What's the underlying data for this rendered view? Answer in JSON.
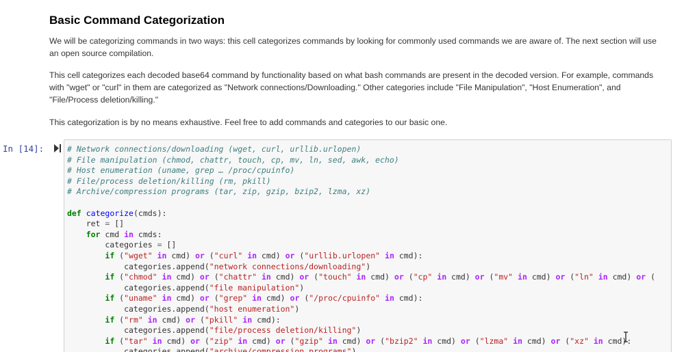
{
  "markdown": {
    "heading": "Basic Command Categorization",
    "paragraphs": [
      "We will be categorizing commands in two ways: this cell categorizes commands by looking for commonly used commands we are aware of. The next section will use an open source compilation.",
      "This cell categorizes each decoded base64 command by functionality based on what bash commands are present in the decoded version. For example, commands with \"wget\" or \"curl\" in them are categorized as \"Network connections/Downloading.\" Other categories include \"File Manipulation\", \"Host Enumeration\", and \"File/Process deletion/killing.\"",
      "This categorization is by no means exhaustive. Feel free to add commands and categories to our basic one."
    ]
  },
  "cell": {
    "prompt": "In [14]:",
    "icons": {
      "run": "run-cell-icon",
      "cursor": "text-cursor-icon"
    },
    "code_lines": [
      [
        [
          "c",
          "# Network connections/downloading (wget, curl, urllib.urlopen)"
        ]
      ],
      [
        [
          "c",
          "# File manipulation (chmod, chattr, touch, cp, mv, ln, sed, awk, echo)"
        ]
      ],
      [
        [
          "c",
          "# Host enumeration (uname, grep … /proc/cpuinfo)"
        ]
      ],
      [
        [
          "c",
          "# File/process deletion/killing (rm, pkill)"
        ]
      ],
      [
        [
          "c",
          "# Archive/compression programs (tar, zip, gzip, bzip2, lzma, xz)"
        ]
      ],
      [],
      [
        [
          "k",
          "def"
        ],
        [
          "",
          " "
        ],
        [
          "nf",
          "categorize"
        ],
        [
          "",
          "(cmds):"
        ]
      ],
      [
        [
          "",
          "    ret "
        ],
        [
          "o",
          "="
        ],
        [
          "",
          " []"
        ]
      ],
      [
        [
          "",
          "    "
        ],
        [
          "k",
          "for"
        ],
        [
          "",
          " cmd "
        ],
        [
          "ow",
          "in"
        ],
        [
          "",
          " cmds:"
        ]
      ],
      [
        [
          "",
          "        categories "
        ],
        [
          "o",
          "="
        ],
        [
          "",
          " []"
        ]
      ],
      [
        [
          "",
          "        "
        ],
        [
          "k",
          "if"
        ],
        [
          "",
          " ("
        ],
        [
          "s",
          "\"wget\""
        ],
        [
          "",
          " "
        ],
        [
          "ow",
          "in"
        ],
        [
          "",
          " cmd) "
        ],
        [
          "ow",
          "or"
        ],
        [
          "",
          " ("
        ],
        [
          "s",
          "\"curl\""
        ],
        [
          "",
          " "
        ],
        [
          "ow",
          "in"
        ],
        [
          "",
          " cmd) "
        ],
        [
          "ow",
          "or"
        ],
        [
          "",
          " ("
        ],
        [
          "s",
          "\"urllib.urlopen\""
        ],
        [
          "",
          " "
        ],
        [
          "ow",
          "in"
        ],
        [
          "",
          " cmd):"
        ]
      ],
      [
        [
          "",
          "            categories.append("
        ],
        [
          "s",
          "\"network connections/downloading\""
        ],
        [
          "",
          ")"
        ]
      ],
      [
        [
          "",
          "        "
        ],
        [
          "k",
          "if"
        ],
        [
          "",
          " ("
        ],
        [
          "s",
          "\"chmod\""
        ],
        [
          "",
          " "
        ],
        [
          "ow",
          "in"
        ],
        [
          "",
          " cmd) "
        ],
        [
          "ow",
          "or"
        ],
        [
          "",
          " ("
        ],
        [
          "s",
          "\"chattr\""
        ],
        [
          "",
          " "
        ],
        [
          "ow",
          "in"
        ],
        [
          "",
          " cmd) "
        ],
        [
          "ow",
          "or"
        ],
        [
          "",
          " ("
        ],
        [
          "s",
          "\"touch\""
        ],
        [
          "",
          " "
        ],
        [
          "ow",
          "in"
        ],
        [
          "",
          " cmd) "
        ],
        [
          "ow",
          "or"
        ],
        [
          "",
          " ("
        ],
        [
          "s",
          "\"cp\""
        ],
        [
          "",
          " "
        ],
        [
          "ow",
          "in"
        ],
        [
          "",
          " cmd) "
        ],
        [
          "ow",
          "or"
        ],
        [
          "",
          " ("
        ],
        [
          "s",
          "\"mv\""
        ],
        [
          "",
          " "
        ],
        [
          "ow",
          "in"
        ],
        [
          "",
          " cmd) "
        ],
        [
          "ow",
          "or"
        ],
        [
          "",
          " ("
        ],
        [
          "s",
          "\"ln\""
        ],
        [
          "",
          " "
        ],
        [
          "ow",
          "in"
        ],
        [
          "",
          " cmd) "
        ],
        [
          "ow",
          "or"
        ],
        [
          "",
          " ("
        ]
      ],
      [
        [
          "",
          "            categories.append("
        ],
        [
          "s",
          "\"file manipulation\""
        ],
        [
          "",
          ")"
        ]
      ],
      [
        [
          "",
          "        "
        ],
        [
          "k",
          "if"
        ],
        [
          "",
          " ("
        ],
        [
          "s",
          "\"uname\""
        ],
        [
          "",
          " "
        ],
        [
          "ow",
          "in"
        ],
        [
          "",
          " cmd) "
        ],
        [
          "ow",
          "or"
        ],
        [
          "",
          " ("
        ],
        [
          "s",
          "\"grep\""
        ],
        [
          "",
          " "
        ],
        [
          "ow",
          "in"
        ],
        [
          "",
          " cmd) "
        ],
        [
          "ow",
          "or"
        ],
        [
          "",
          " ("
        ],
        [
          "s",
          "\"/proc/cpuinfo\""
        ],
        [
          "",
          " "
        ],
        [
          "ow",
          "in"
        ],
        [
          "",
          " cmd):"
        ]
      ],
      [
        [
          "",
          "            categories.append("
        ],
        [
          "s",
          "\"host enumeration\""
        ],
        [
          "",
          ")"
        ]
      ],
      [
        [
          "",
          "        "
        ],
        [
          "k",
          "if"
        ],
        [
          "",
          " ("
        ],
        [
          "s",
          "\"rm\""
        ],
        [
          "",
          " "
        ],
        [
          "ow",
          "in"
        ],
        [
          "",
          " cmd) "
        ],
        [
          "ow",
          "or"
        ],
        [
          "",
          " ("
        ],
        [
          "s",
          "\"pkill\""
        ],
        [
          "",
          " "
        ],
        [
          "ow",
          "in"
        ],
        [
          "",
          " cmd):"
        ]
      ],
      [
        [
          "",
          "            categories.append("
        ],
        [
          "s",
          "\"file/process deletion/killing\""
        ],
        [
          "",
          ")"
        ]
      ],
      [
        [
          "",
          "        "
        ],
        [
          "k",
          "if"
        ],
        [
          "",
          " ("
        ],
        [
          "s",
          "\"tar\""
        ],
        [
          "",
          " "
        ],
        [
          "ow",
          "in"
        ],
        [
          "",
          " cmd) "
        ],
        [
          "ow",
          "or"
        ],
        [
          "",
          " ("
        ],
        [
          "s",
          "\"zip\""
        ],
        [
          "",
          " "
        ],
        [
          "ow",
          "in"
        ],
        [
          "",
          " cmd) "
        ],
        [
          "ow",
          "or"
        ],
        [
          "",
          " ("
        ],
        [
          "s",
          "\"gzip\""
        ],
        [
          "",
          " "
        ],
        [
          "ow",
          "in"
        ],
        [
          "",
          " cmd) "
        ],
        [
          "ow",
          "or"
        ],
        [
          "",
          " ("
        ],
        [
          "s",
          "\"bzip2\""
        ],
        [
          "",
          " "
        ],
        [
          "ow",
          "in"
        ],
        [
          "",
          " cmd) "
        ],
        [
          "ow",
          "or"
        ],
        [
          "",
          " ("
        ],
        [
          "s",
          "\"lzma\""
        ],
        [
          "",
          " "
        ],
        [
          "ow",
          "in"
        ],
        [
          "",
          " cmd) "
        ],
        [
          "ow",
          "or"
        ],
        [
          "",
          " ("
        ],
        [
          "s",
          "\"xz\""
        ],
        [
          "",
          " "
        ],
        [
          "ow",
          "in"
        ],
        [
          "",
          " cmd):"
        ]
      ],
      [
        [
          "",
          "            categories.append("
        ],
        [
          "s",
          "\"archive/compression programs\""
        ],
        [
          "",
          ")"
        ]
      ]
    ]
  }
}
